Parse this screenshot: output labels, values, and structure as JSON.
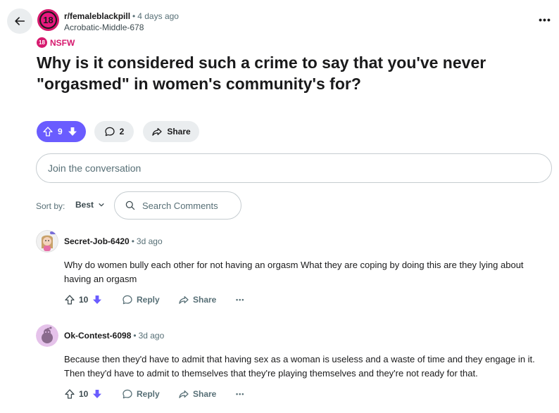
{
  "header": {
    "subreddit": "r/femaleblackpill",
    "time": "4 days ago",
    "author": "Acrobatic-Middle-678",
    "avatar_text": "18",
    "more": "•••"
  },
  "nsfw": {
    "badge": "18",
    "label": "NSFW"
  },
  "post": {
    "title": "Why is it considered such a crime to say that you've never \"orgasmed\" in women's community's for?",
    "votes": "9",
    "comments": "2",
    "share_label": "Share"
  },
  "join": {
    "placeholder": "Join the conversation"
  },
  "sort": {
    "label": "Sort by:",
    "value": "Best"
  },
  "search": {
    "placeholder": "Search Comments"
  },
  "comments": [
    {
      "user": "Secret-Job-6420",
      "time": "3d ago",
      "body": "Why do women bully each other for not having an orgasm What they are coping by doing this are they lying about having an orgasm",
      "votes": "10",
      "reply_label": "Reply",
      "share_label": "Share",
      "more": "•••"
    },
    {
      "user": "Ok-Contest-6098",
      "time": "3d ago",
      "body": "Because then they'd have to admit that having sex as a woman is useless and a waste of time and they engage in it. Then they'd have to admit to themselves that they're playing themselves and they're not ready for that.",
      "votes": "10",
      "reply_label": "Reply",
      "share_label": "Share",
      "more": "•••"
    }
  ],
  "colors": {
    "accent": "#6a5cff",
    "nsfw": "#d6196e",
    "muted": "#576f76",
    "pill_bg": "#eaedef"
  }
}
